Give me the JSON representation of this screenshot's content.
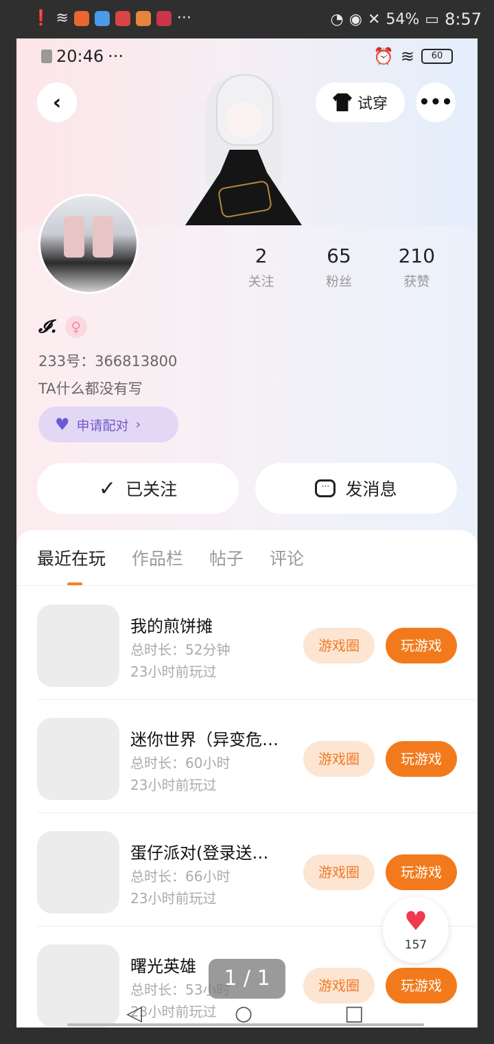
{
  "device_status": {
    "battery": "54%",
    "time": "8:57",
    "icons": [
      "alert-icon",
      "wifi-icon",
      "app-icon",
      "app-icon",
      "app-icon",
      "app-icon",
      "app-icon",
      "more-dots-icon",
      "nfc-icon",
      "eye-icon",
      "mute-icon",
      "battery-icon"
    ]
  },
  "app_status": {
    "time": "20:46",
    "dots": "···",
    "battery": "60"
  },
  "header": {
    "back_icon": "chevron-left-icon",
    "tryon_label": "试穿",
    "more_icon": "more-dots-icon"
  },
  "profile": {
    "stats": [
      {
        "num": "2",
        "label": "关注"
      },
      {
        "num": "65",
        "label": "粉丝"
      },
      {
        "num": "210",
        "label": "获赞"
      }
    ],
    "nickname": "𝓘.",
    "gender_icon": "female-icon",
    "user_id": "233号：366813800",
    "bio": "TA什么都没有写",
    "pair_label": "申请配对"
  },
  "actions": {
    "follow_label": "已关注",
    "message_label": "发消息"
  },
  "tabs": [
    {
      "label": "最近在玩",
      "active": true
    },
    {
      "label": "作品栏",
      "active": false
    },
    {
      "label": "帖子",
      "active": false
    },
    {
      "label": "评论",
      "active": false
    }
  ],
  "games": [
    {
      "title": "我的煎饼摊",
      "duration": "总时长：52分钟",
      "last_played": "23小时前玩过",
      "circle_label": "游戏圈",
      "play_label": "玩游戏"
    },
    {
      "title": "迷你世界（异变危…",
      "duration": "总时长：60小时",
      "last_played": "23小时前玩过",
      "circle_label": "游戏圈",
      "play_label": "玩游戏"
    },
    {
      "title": "蛋仔派对(登录送…",
      "duration": "总时长：66小时",
      "last_played": "23小时前玩过",
      "circle_label": "游戏圈",
      "play_label": "玩游戏"
    },
    {
      "title": "曙光英雄",
      "duration": "总时长：53小时",
      "last_played": "23小时前玩过",
      "circle_label": "游戏圈",
      "play_label": "玩游戏"
    }
  ],
  "like_float": {
    "count": "157"
  },
  "page_indicator": "1 / 1",
  "colors": {
    "accent": "#f27a1c",
    "accent_light": "#fde5d3",
    "pair_purple": "#6e5bc7",
    "like_red": "#f0384f"
  }
}
